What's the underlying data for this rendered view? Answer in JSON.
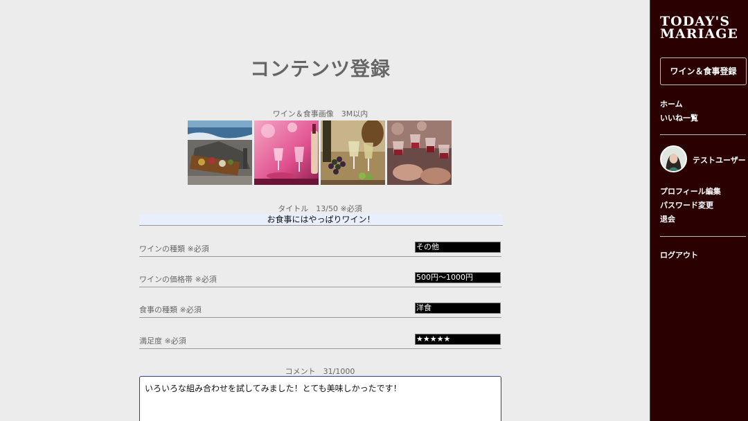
{
  "main": {
    "page_title": "コンテンツ登録",
    "image_label": "ワイン＆食事画像　3M以内",
    "images": [
      {
        "icon": "seaside-picnic-photo"
      },
      {
        "icon": "pink-wine-glasses-photo"
      },
      {
        "icon": "grapes-white-wine-photo"
      },
      {
        "icon": "toast-red-wine-photo"
      }
    ],
    "title_label": "タイトル　13/50 ※必須",
    "title_value": "お食事にはやっぱりワイン！",
    "fields": [
      {
        "label": "ワインの種類 ※必須",
        "value": "その他"
      },
      {
        "label": "ワインの価格帯 ※必須",
        "value": "500円〜1000円"
      },
      {
        "label": "食事の種類 ※必須",
        "value": "洋食"
      },
      {
        "label": "満足度 ※必須",
        "value": "★★★★★"
      }
    ],
    "comment_label": "コメント　31/1000",
    "comment_value": "いろいろな組み合わせを試してみました！とても美味しかったです！"
  },
  "sidebar": {
    "logo_line1": "TODAY'S",
    "logo_line2": "MARIAGE",
    "register_button": "ワイン＆食事登録",
    "nav": [
      "ホーム",
      "いいね一覧"
    ],
    "user_name": "テストユーザー",
    "account_links": [
      "プロフィール編集",
      "パスワード変更",
      "退会"
    ],
    "logout": "ログアウト"
  },
  "colors": {
    "sidebar_bg": "#2a0000",
    "page_bg": "#ececec",
    "select_bg": "#000000",
    "title_input_bg": "#e8eefb",
    "comment_border": "#2a3f8f"
  }
}
